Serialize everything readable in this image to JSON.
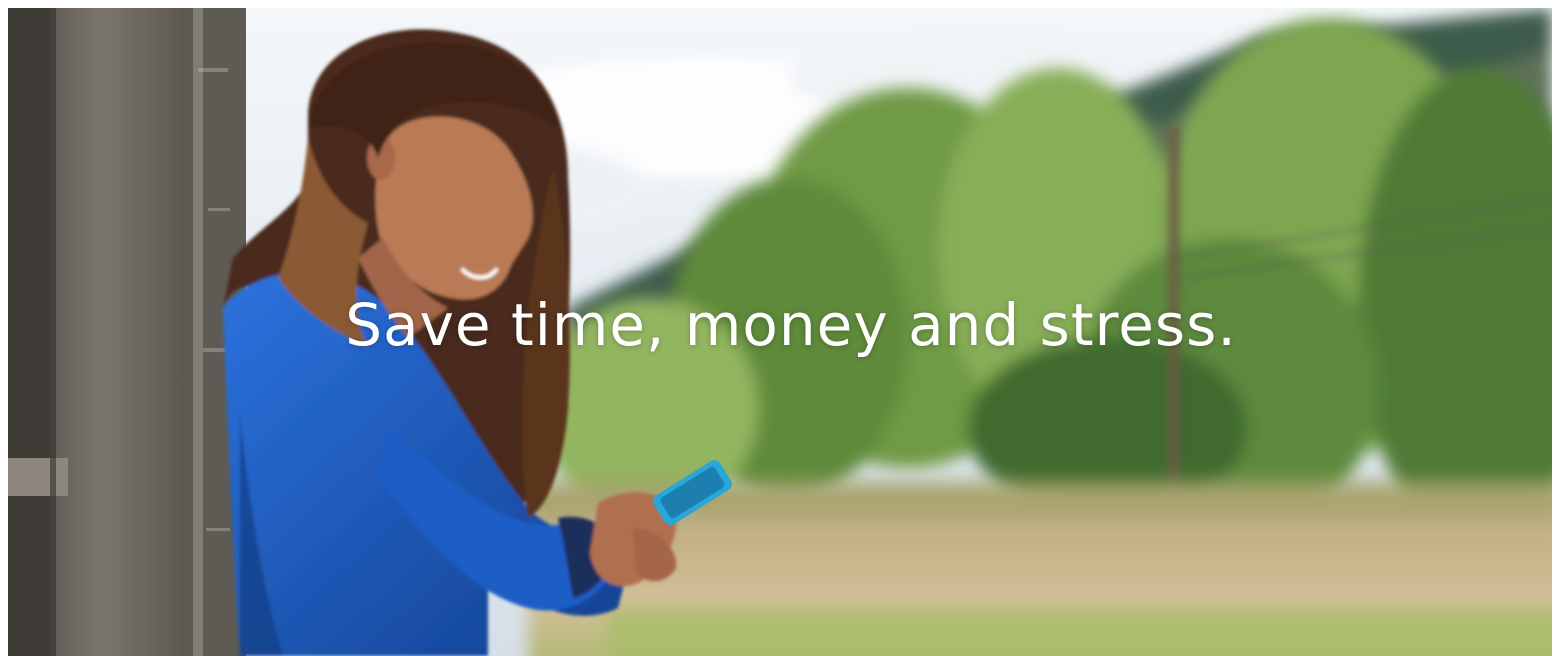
{
  "hero": {
    "headline": "Save time, money and stress.",
    "image": {
      "subject": "person-using-phone-outdoors",
      "colors": {
        "sky": "#dfe6ee",
        "hills": "#3b5a4a",
        "trees_light": "#8fb35c",
        "trees_dark": "#4f7a36",
        "field": "#c9b48a",
        "jacket": "#1f5fc7",
        "hair": "#4a2a1a",
        "skin": "#b97a55",
        "phone": "#2aa7d6",
        "wood": "#6e6a63"
      }
    }
  }
}
